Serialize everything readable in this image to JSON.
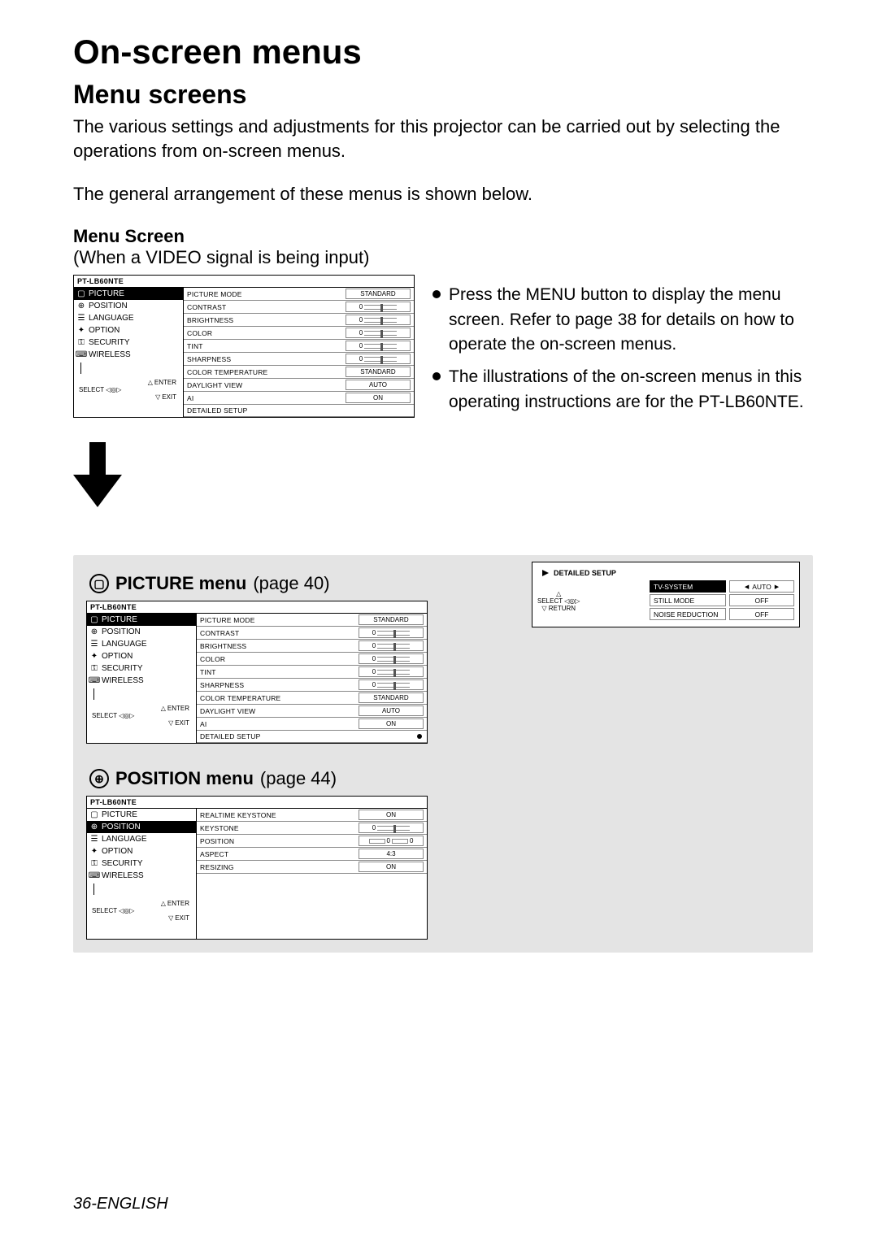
{
  "title": "On-screen menus",
  "subtitle": "Menu screens",
  "intro1": "The various settings and adjustments for this projector can be carried out by selecting the operations from on-screen menus.",
  "intro2": "The general arrangement of these menus is shown below.",
  "menu_screen_label": "Menu Screen",
  "menu_screen_note": "(When a VIDEO signal is being input)",
  "bullets": [
    "Press the MENU button to display the menu screen. Refer to page 38 for details on how to operate the on-screen menus.",
    "The illustrations of the on-screen menus in this operating instructions are for the PT-LB60NTE."
  ],
  "osd": {
    "model": "PT-LB60NTE",
    "nav": [
      "PICTURE",
      "POSITION",
      "LANGUAGE",
      "OPTION",
      "SECURITY",
      "WIRELESS"
    ],
    "foot": {
      "select": "SELECT",
      "enter": "ENTER",
      "exit": "EXIT",
      "return": "RETURN"
    },
    "picture_items": [
      {
        "label": "PICTURE MODE",
        "val": "STANDARD",
        "type": "text"
      },
      {
        "label": "CONTRAST",
        "val": "0",
        "type": "slider"
      },
      {
        "label": "BRIGHTNESS",
        "val": "0",
        "type": "slider"
      },
      {
        "label": "COLOR",
        "val": "0",
        "type": "slider"
      },
      {
        "label": "TINT",
        "val": "0",
        "type": "slider"
      },
      {
        "label": "SHARPNESS",
        "val": "0",
        "type": "slider"
      },
      {
        "label": "COLOR TEMPERATURE",
        "val": "STANDARD",
        "type": "text"
      },
      {
        "label": "DAYLIGHT VIEW",
        "val": "AUTO",
        "type": "text"
      },
      {
        "label": "AI",
        "val": "ON",
        "type": "text"
      },
      {
        "label": "DETAILED SETUP",
        "val": "",
        "type": "none"
      }
    ],
    "position_items": [
      {
        "label": "REALTIME KEYSTONE",
        "val": "ON",
        "type": "text"
      },
      {
        "label": "KEYSTONE",
        "val": "0",
        "type": "slider"
      },
      {
        "label": "POSITION",
        "val": "0 0",
        "type": "pos"
      },
      {
        "label": "ASPECT",
        "val": "4:3",
        "type": "text"
      },
      {
        "label": "RESIZING",
        "val": "ON",
        "type": "text"
      }
    ]
  },
  "picture_sec": {
    "title": "PICTURE menu",
    "page_label": "(page 40)"
  },
  "position_sec": {
    "title": "POSITION menu",
    "page_label": "(page 44)"
  },
  "detailed_setup": {
    "header": "DETAILED SETUP",
    "rows": [
      {
        "label": "TV-SYSTEM",
        "val": "AUTO",
        "sel": true
      },
      {
        "label": "STILL MODE",
        "val": "OFF",
        "sel": false
      },
      {
        "label": "NOISE REDUCTION",
        "val": "OFF",
        "sel": false
      }
    ]
  },
  "footer": {
    "page": "36-",
    "lang": "ENGLISH"
  }
}
